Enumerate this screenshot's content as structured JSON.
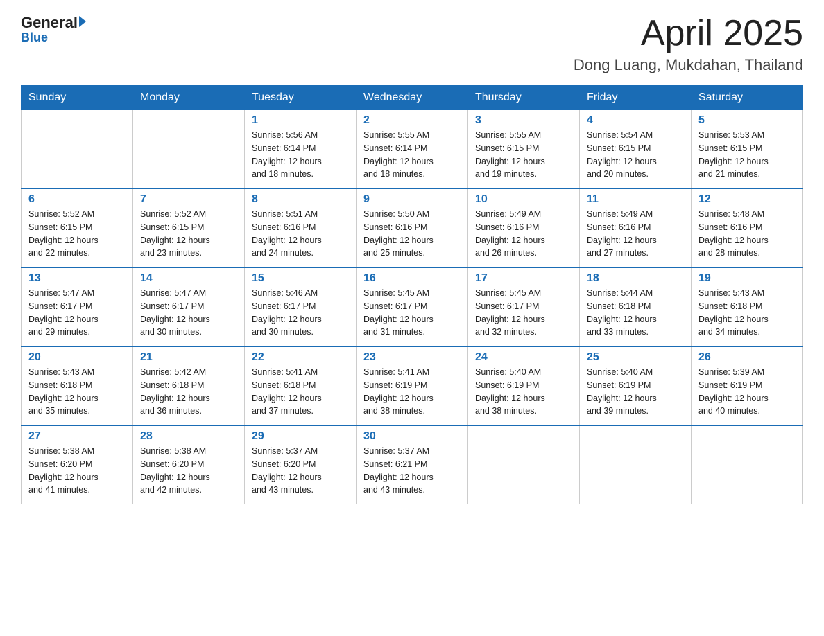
{
  "header": {
    "logo_general": "General",
    "logo_blue": "Blue",
    "title": "April 2025",
    "subtitle": "Dong Luang, Mukdahan, Thailand"
  },
  "days_of_week": [
    "Sunday",
    "Monday",
    "Tuesday",
    "Wednesday",
    "Thursday",
    "Friday",
    "Saturday"
  ],
  "weeks": [
    [
      {
        "day": "",
        "info": ""
      },
      {
        "day": "",
        "info": ""
      },
      {
        "day": "1",
        "info": "Sunrise: 5:56 AM\nSunset: 6:14 PM\nDaylight: 12 hours\nand 18 minutes."
      },
      {
        "day": "2",
        "info": "Sunrise: 5:55 AM\nSunset: 6:14 PM\nDaylight: 12 hours\nand 18 minutes."
      },
      {
        "day": "3",
        "info": "Sunrise: 5:55 AM\nSunset: 6:15 PM\nDaylight: 12 hours\nand 19 minutes."
      },
      {
        "day": "4",
        "info": "Sunrise: 5:54 AM\nSunset: 6:15 PM\nDaylight: 12 hours\nand 20 minutes."
      },
      {
        "day": "5",
        "info": "Sunrise: 5:53 AM\nSunset: 6:15 PM\nDaylight: 12 hours\nand 21 minutes."
      }
    ],
    [
      {
        "day": "6",
        "info": "Sunrise: 5:52 AM\nSunset: 6:15 PM\nDaylight: 12 hours\nand 22 minutes."
      },
      {
        "day": "7",
        "info": "Sunrise: 5:52 AM\nSunset: 6:15 PM\nDaylight: 12 hours\nand 23 minutes."
      },
      {
        "day": "8",
        "info": "Sunrise: 5:51 AM\nSunset: 6:16 PM\nDaylight: 12 hours\nand 24 minutes."
      },
      {
        "day": "9",
        "info": "Sunrise: 5:50 AM\nSunset: 6:16 PM\nDaylight: 12 hours\nand 25 minutes."
      },
      {
        "day": "10",
        "info": "Sunrise: 5:49 AM\nSunset: 6:16 PM\nDaylight: 12 hours\nand 26 minutes."
      },
      {
        "day": "11",
        "info": "Sunrise: 5:49 AM\nSunset: 6:16 PM\nDaylight: 12 hours\nand 27 minutes."
      },
      {
        "day": "12",
        "info": "Sunrise: 5:48 AM\nSunset: 6:16 PM\nDaylight: 12 hours\nand 28 minutes."
      }
    ],
    [
      {
        "day": "13",
        "info": "Sunrise: 5:47 AM\nSunset: 6:17 PM\nDaylight: 12 hours\nand 29 minutes."
      },
      {
        "day": "14",
        "info": "Sunrise: 5:47 AM\nSunset: 6:17 PM\nDaylight: 12 hours\nand 30 minutes."
      },
      {
        "day": "15",
        "info": "Sunrise: 5:46 AM\nSunset: 6:17 PM\nDaylight: 12 hours\nand 30 minutes."
      },
      {
        "day": "16",
        "info": "Sunrise: 5:45 AM\nSunset: 6:17 PM\nDaylight: 12 hours\nand 31 minutes."
      },
      {
        "day": "17",
        "info": "Sunrise: 5:45 AM\nSunset: 6:17 PM\nDaylight: 12 hours\nand 32 minutes."
      },
      {
        "day": "18",
        "info": "Sunrise: 5:44 AM\nSunset: 6:18 PM\nDaylight: 12 hours\nand 33 minutes."
      },
      {
        "day": "19",
        "info": "Sunrise: 5:43 AM\nSunset: 6:18 PM\nDaylight: 12 hours\nand 34 minutes."
      }
    ],
    [
      {
        "day": "20",
        "info": "Sunrise: 5:43 AM\nSunset: 6:18 PM\nDaylight: 12 hours\nand 35 minutes."
      },
      {
        "day": "21",
        "info": "Sunrise: 5:42 AM\nSunset: 6:18 PM\nDaylight: 12 hours\nand 36 minutes."
      },
      {
        "day": "22",
        "info": "Sunrise: 5:41 AM\nSunset: 6:18 PM\nDaylight: 12 hours\nand 37 minutes."
      },
      {
        "day": "23",
        "info": "Sunrise: 5:41 AM\nSunset: 6:19 PM\nDaylight: 12 hours\nand 38 minutes."
      },
      {
        "day": "24",
        "info": "Sunrise: 5:40 AM\nSunset: 6:19 PM\nDaylight: 12 hours\nand 38 minutes."
      },
      {
        "day": "25",
        "info": "Sunrise: 5:40 AM\nSunset: 6:19 PM\nDaylight: 12 hours\nand 39 minutes."
      },
      {
        "day": "26",
        "info": "Sunrise: 5:39 AM\nSunset: 6:19 PM\nDaylight: 12 hours\nand 40 minutes."
      }
    ],
    [
      {
        "day": "27",
        "info": "Sunrise: 5:38 AM\nSunset: 6:20 PM\nDaylight: 12 hours\nand 41 minutes."
      },
      {
        "day": "28",
        "info": "Sunrise: 5:38 AM\nSunset: 6:20 PM\nDaylight: 12 hours\nand 42 minutes."
      },
      {
        "day": "29",
        "info": "Sunrise: 5:37 AM\nSunset: 6:20 PM\nDaylight: 12 hours\nand 43 minutes."
      },
      {
        "day": "30",
        "info": "Sunrise: 5:37 AM\nSunset: 6:21 PM\nDaylight: 12 hours\nand 43 minutes."
      },
      {
        "day": "",
        "info": ""
      },
      {
        "day": "",
        "info": ""
      },
      {
        "day": "",
        "info": ""
      }
    ]
  ]
}
